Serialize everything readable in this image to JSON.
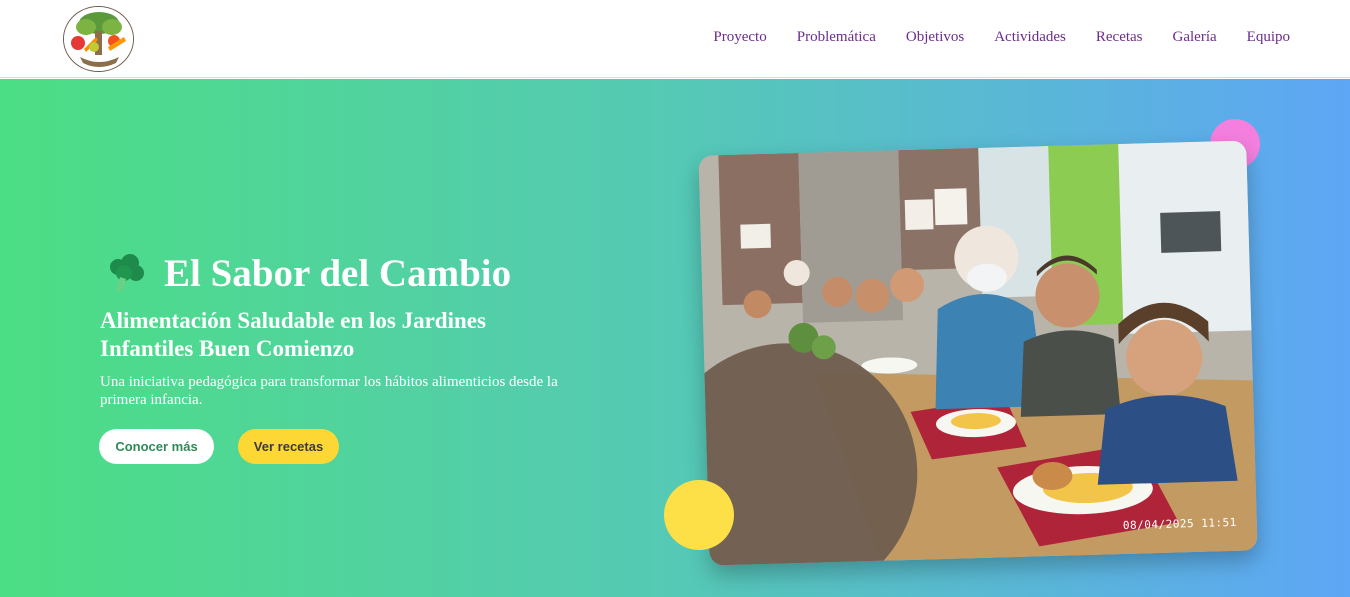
{
  "header": {
    "logo_icon": "garden-tree-vegetables-logo",
    "nav": [
      {
        "label": "Proyecto"
      },
      {
        "label": "Problemática"
      },
      {
        "label": "Objetivos"
      },
      {
        "label": "Actividades"
      },
      {
        "label": "Recetas"
      },
      {
        "label": "Galería"
      },
      {
        "label": "Equipo"
      }
    ],
    "nav_color": "#6b2d8c"
  },
  "hero": {
    "title_icon": "broccoli-icon",
    "title": "El Sabor del Cambio",
    "subtitle": "Alimentación Saludable en los Jardines Infantiles Buen Comienzo",
    "description": "Una iniciativa pedagógica para transformar los hábitos alimenticios desde la primera infancia.",
    "primary_button": "Conocer más",
    "secondary_button": "Ver recetas",
    "photo_timestamp": "08/04/2025  11:51",
    "gradient": [
      "#4cde84",
      "#5ea6f6"
    ],
    "accent_pink": "#f47fdf",
    "accent_yellow": "#fde047"
  }
}
